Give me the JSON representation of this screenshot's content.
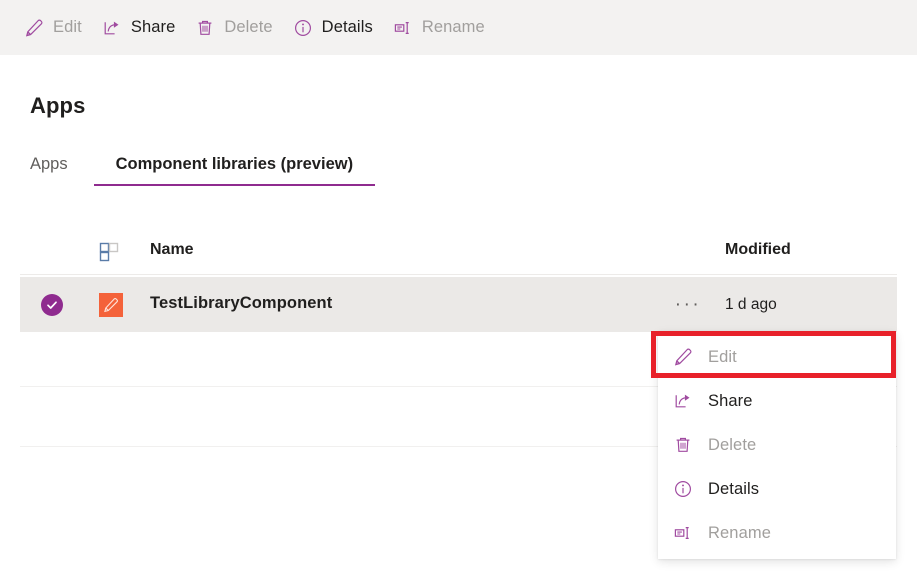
{
  "colors": {
    "accent_purple": "#8f2b8f",
    "icon_purple": "#a04ba0",
    "app_icon_orange": "#f4623a",
    "annotation_red": "#e8212a",
    "commandbar_bg": "#f3f2f1",
    "selected_row_bg": "#ebe9e7",
    "text_primary": "#201f1e",
    "text_disabled": "#a19f9d"
  },
  "commandbar": {
    "items": [
      {
        "label": "Edit",
        "icon": "pencil-icon",
        "enabled": false
      },
      {
        "label": "Share",
        "icon": "share-icon",
        "enabled": true
      },
      {
        "label": "Delete",
        "icon": "trash-icon",
        "enabled": false
      },
      {
        "label": "Details",
        "icon": "info-icon",
        "enabled": true
      },
      {
        "label": "Rename",
        "icon": "rename-icon",
        "enabled": false
      }
    ]
  },
  "page": {
    "title": "Apps"
  },
  "tabs": [
    {
      "label": "Apps",
      "active": false
    },
    {
      "label": "Component libraries (preview)",
      "active": true
    }
  ],
  "list": {
    "header": {
      "icon": "component-grid-icon",
      "name_column": "Name",
      "modified_column": "Modified"
    },
    "rows": [
      {
        "selected": true,
        "check_icon": "check-circle-icon",
        "app_icon": "pencil-app-icon",
        "name": "TestLibraryComponent",
        "overflow_icon": "ellipsis-icon",
        "overflow_label": "···",
        "modified": "1 d ago"
      }
    ]
  },
  "context_menu": {
    "items": [
      {
        "label": "Edit",
        "icon": "pencil-icon",
        "enabled": false,
        "highlighted": true
      },
      {
        "label": "Share",
        "icon": "share-icon",
        "enabled": true,
        "highlighted": false
      },
      {
        "label": "Delete",
        "icon": "trash-icon",
        "enabled": false,
        "highlighted": false
      },
      {
        "label": "Details",
        "icon": "info-icon",
        "enabled": true,
        "highlighted": false
      },
      {
        "label": "Rename",
        "icon": "rename-icon",
        "enabled": false,
        "highlighted": false
      }
    ]
  }
}
